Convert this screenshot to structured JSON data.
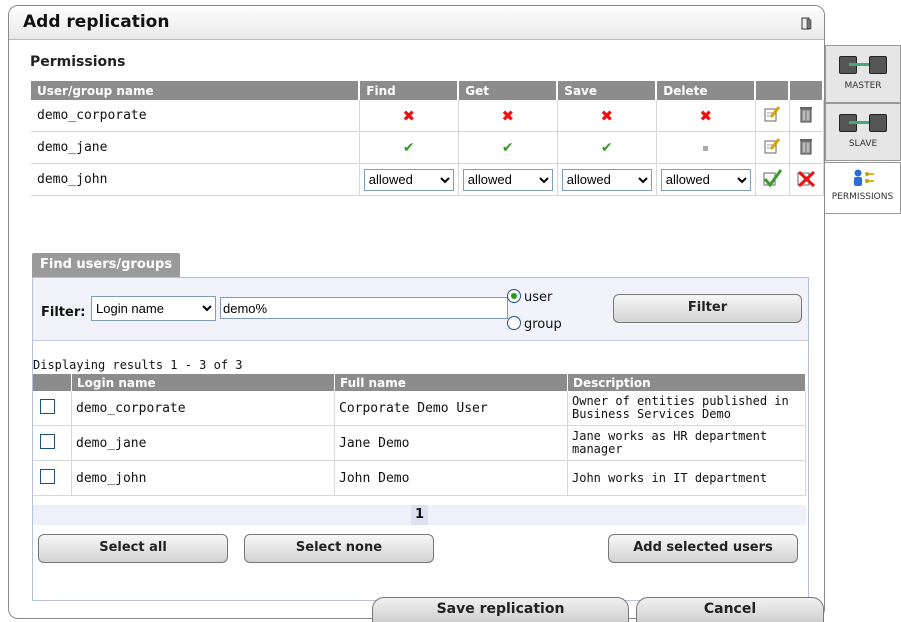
{
  "dialog": {
    "title": "Add replication",
    "section_title": "Permissions"
  },
  "permissions": {
    "headers": [
      "User/group name",
      "Find",
      "Get",
      "Save",
      "Delete"
    ],
    "rows": [
      {
        "name": "demo_corporate",
        "state": [
          "x",
          "x",
          "x",
          "x"
        ]
      },
      {
        "name": "demo_jane",
        "state": [
          "check",
          "check",
          "check",
          "dot"
        ]
      },
      {
        "name": "demo_john",
        "editing": true,
        "values": [
          "allowed",
          "allowed",
          "allowed",
          "allowed"
        ]
      }
    ]
  },
  "find": {
    "tab_label": "Find users/groups",
    "filter_label": "Filter:",
    "filter_field": "Login name",
    "filter_value": "demo%",
    "radio_user": "user",
    "radio_group": "group",
    "filter_button": "Filter",
    "results_info": "Displaying results 1 - 3 of 3",
    "columns": [
      "Login name",
      "Full name",
      "Description"
    ],
    "rows": [
      {
        "login": "demo_corporate",
        "full": "Corporate Demo User",
        "desc": "Owner of entities published in Business Services Demo"
      },
      {
        "login": "demo_jane",
        "full": "Jane Demo",
        "desc": "Jane works as HR department manager"
      },
      {
        "login": "demo_john",
        "full": "John Demo",
        "desc": "John works in IT department"
      }
    ],
    "page": "1",
    "select_all": "Select all",
    "select_none": "Select none",
    "add_selected": "Add selected users"
  },
  "footer": {
    "save": "Save replication",
    "cancel": "Cancel"
  },
  "side_tabs": [
    {
      "label": "MASTER",
      "icon": "network-computers-icon"
    },
    {
      "label": "SLAVE",
      "icon": "network-computers-icon"
    },
    {
      "label": "PERMISSIONS",
      "icon": "users-keys-icon"
    }
  ],
  "colors": {
    "header_gray": "#8c8c8c",
    "deny": "#e11111",
    "allow": "#3a9a2a"
  }
}
